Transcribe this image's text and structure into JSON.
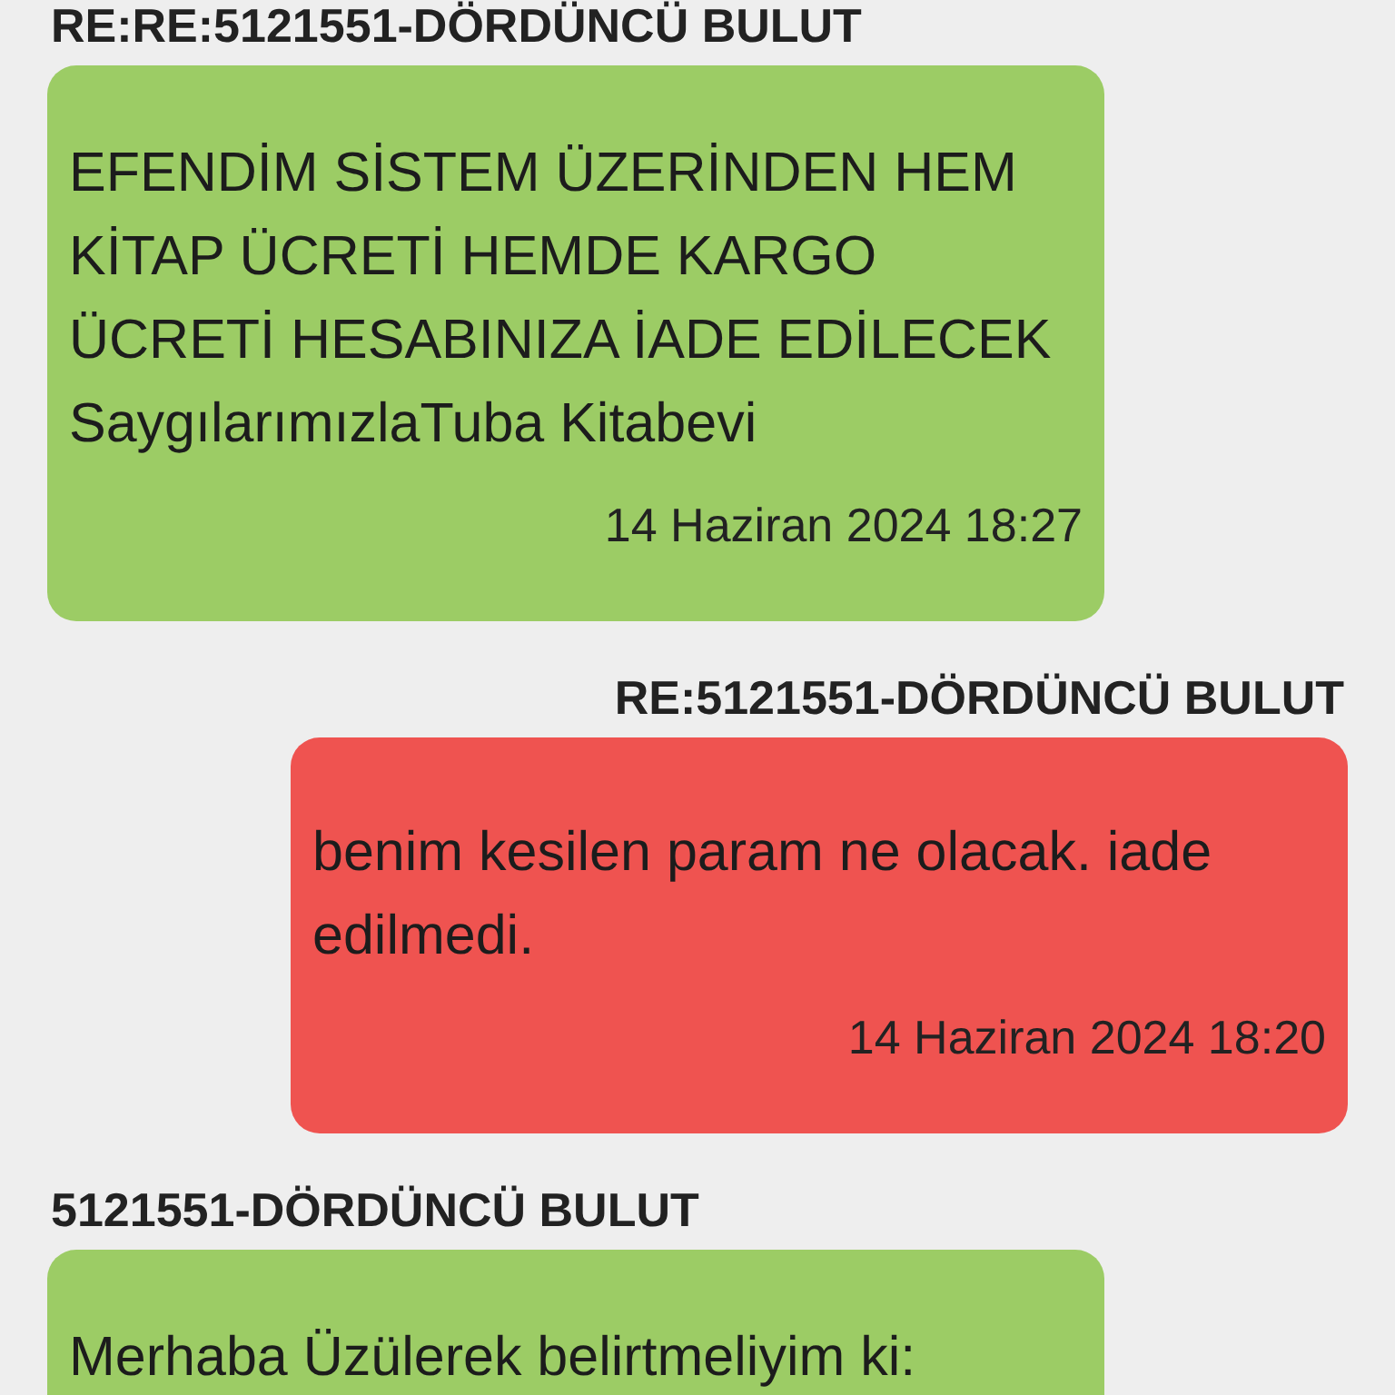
{
  "messages": [
    {
      "subject": "RE:RE:5121551-DÖRDÜNCÜ BULUT",
      "kind": "incoming",
      "body": "EFENDİM SİSTEM ÜZERİNDEN HEM KİTAP ÜCRETİ HEMDE KARGO ÜCRETİ HESABINIZA İADE EDİLECEK\nSaygılarımızlaTuba Kitabevi",
      "time": "14 Haziran 2024 18:27"
    },
    {
      "subject": "RE:5121551-DÖRDÜNCÜ BULUT",
      "kind": "outgoing",
      "body": "benim kesilen param ne olacak. iade edilmedi.",
      "time": "14 Haziran 2024 18:20"
    },
    {
      "subject": "5121551-DÖRDÜNCÜ BULUT",
      "kind": "incoming",
      "body": "Merhaba Üzülerek belirtmeliyim ki:"
    }
  ]
}
